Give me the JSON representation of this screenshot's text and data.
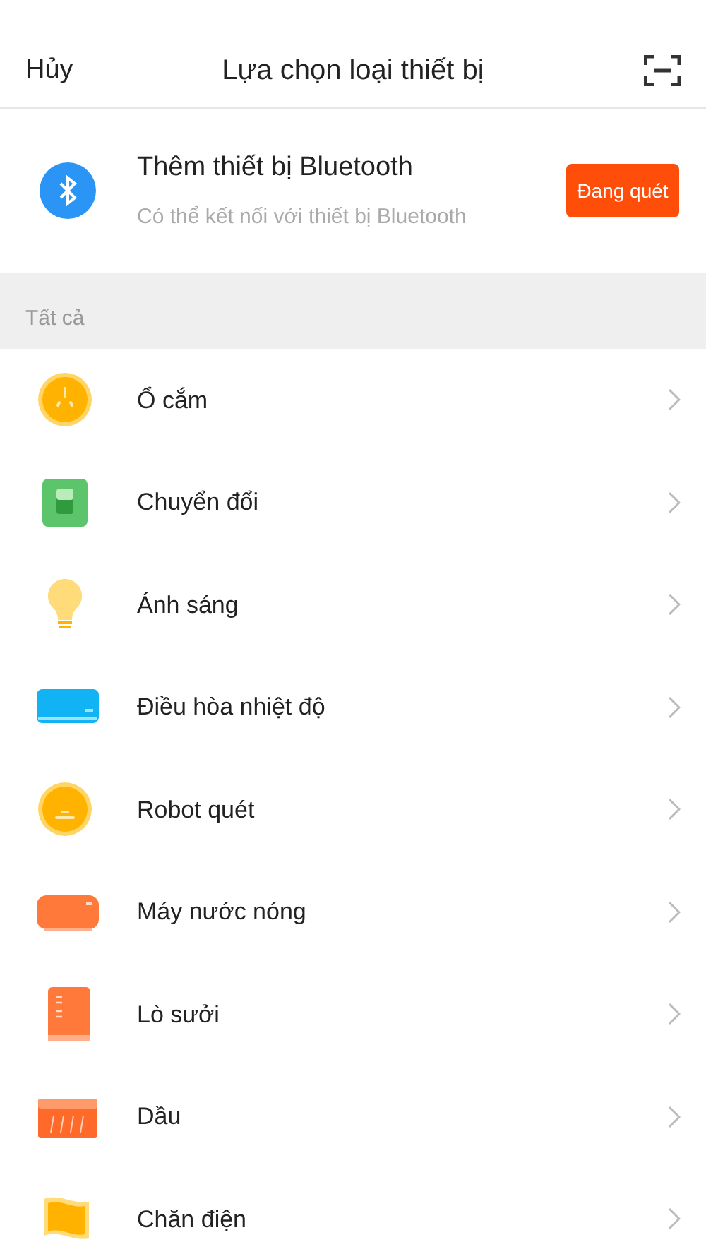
{
  "header": {
    "cancel": "Hủy",
    "title": "Lựa chọn loại thiết bị"
  },
  "bluetooth": {
    "title": "Thêm thiết bị Bluetooth",
    "subtitle": "Có thể kết nối với thiết bị Bluetooth",
    "button": "Đang quét"
  },
  "section": {
    "label": "Tất cả"
  },
  "devices": [
    {
      "kind": "socket",
      "label": "Ổ cắm"
    },
    {
      "kind": "switch",
      "label": "Chuyển đổi"
    },
    {
      "kind": "bulb",
      "label": "Ánh sáng"
    },
    {
      "kind": "aircon",
      "label": "Điều hòa nhiệt độ"
    },
    {
      "kind": "robot",
      "label": "Robot quét"
    },
    {
      "kind": "boiler",
      "label": "Máy nước nóng"
    },
    {
      "kind": "heater",
      "label": "Lò sưởi"
    },
    {
      "kind": "radiator",
      "label": "Dầu"
    },
    {
      "kind": "blanket",
      "label": "Chăn điện"
    }
  ]
}
